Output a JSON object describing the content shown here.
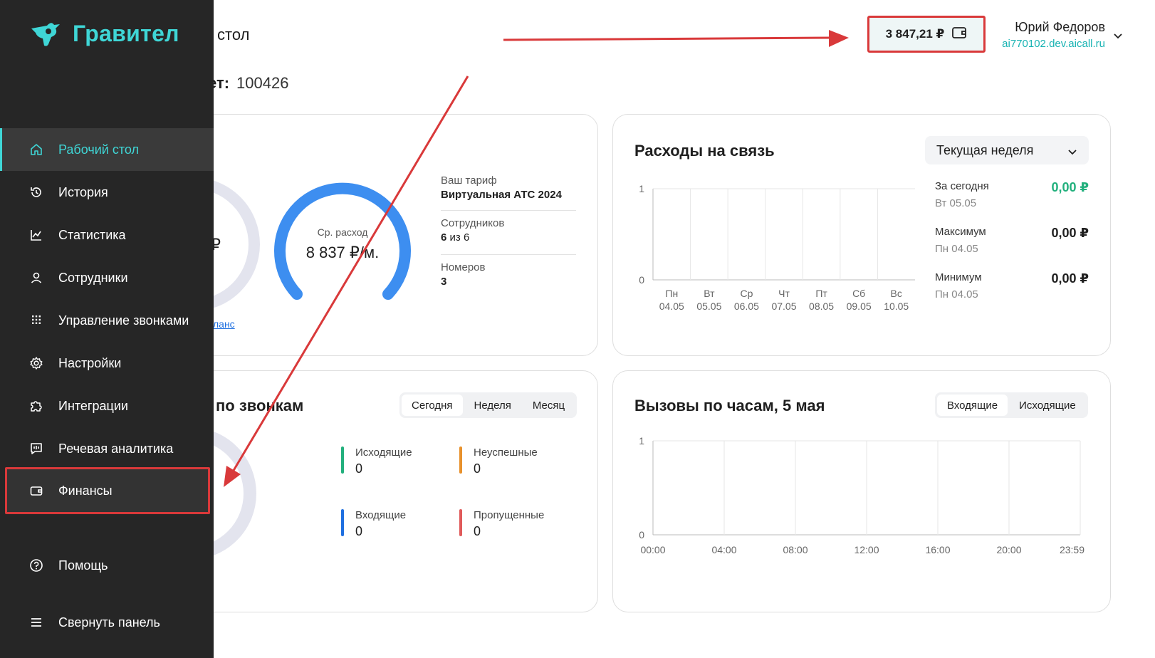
{
  "sidebar": {
    "logo_text": "Гравител",
    "items": [
      {
        "label": "Рабочий стол",
        "icon": "home-icon"
      },
      {
        "label": "История",
        "icon": "history-icon"
      },
      {
        "label": "Статистика",
        "icon": "chart-icon"
      },
      {
        "label": "Сотрудники",
        "icon": "user-icon"
      },
      {
        "label": "Управление звонками",
        "icon": "dialpad-icon"
      },
      {
        "label": "Настройки",
        "icon": "gear-icon"
      },
      {
        "label": "Интеграции",
        "icon": "puzzle-icon"
      },
      {
        "label": "Речевая аналитика",
        "icon": "speech-icon"
      },
      {
        "label": "Финансы",
        "icon": "wallet-icon"
      }
    ],
    "help_label": "Помощь",
    "collapse_label": "Свернуть панель"
  },
  "header": {
    "title_fragment": "стол",
    "account_label": "ет:",
    "account_number": "100426",
    "balance": "3 847,21 ₽",
    "user_name": "Юрий Федоров",
    "user_domain": "ai770102.dev.aicall.ru"
  },
  "tariff_card": {
    "gauge_fragment": "₽",
    "avg_label": "Ср. расход",
    "avg_value": "8 837 ₽/м.",
    "link_fragment": "ланс",
    "tariff_label": "Ваш тариф",
    "tariff_value": "Виртуальная АТС 2024",
    "employees_label": "Сотрудников",
    "employees_value": "6",
    "employees_of": "из 6",
    "numbers_label": "Номеров",
    "numbers_value": "3"
  },
  "expenses_card": {
    "title": "Расходы на связь",
    "period": "Текущая неделя",
    "today_label": "За сегодня",
    "today_date": "Вт 05.05",
    "today_value": "0,00 ₽",
    "max_label": "Максимум",
    "max_date": "Пн 04.05",
    "max_value": "0,00 ₽",
    "min_label": "Минимум",
    "min_date": "Пн 04.05",
    "min_value": "0,00 ₽"
  },
  "calls_card": {
    "title_fragment": "по звонкам",
    "tabs": [
      "Сегодня",
      "Неделя",
      "Месяц"
    ],
    "outgoing_label": "Исходящие",
    "outgoing_value": "0",
    "failed_label": "Неуспешные",
    "failed_value": "0",
    "incoming_label": "Входящие",
    "incoming_value": "0",
    "missed_label": "Пропущенные",
    "missed_value": "0"
  },
  "hourly_card": {
    "title": "Вызовы по часам, 5 мая",
    "tabs": [
      "Входящие",
      "Исходящие"
    ]
  },
  "chart_data": [
    {
      "type": "bar",
      "categories": [
        "Пн 04.05",
        "Вт 05.05",
        "Ср 06.05",
        "Чт 07.05",
        "Пт 08.05",
        "Сб 09.05",
        "Вс 10.05"
      ],
      "cat_day": [
        "Пн",
        "Вт",
        "Ср",
        "Чт",
        "Пт",
        "Сб",
        "Вс"
      ],
      "cat_date": [
        "04.05",
        "05.05",
        "06.05",
        "07.05",
        "08.05",
        "09.05",
        "10.05"
      ],
      "values": [
        0,
        0,
        0,
        0,
        0,
        0,
        0
      ],
      "ylim": [
        0,
        1
      ],
      "yticks": [
        "0",
        "1"
      ]
    },
    {
      "type": "line",
      "x": [
        "00:00",
        "04:00",
        "08:00",
        "12:00",
        "16:00",
        "20:00",
        "23:59"
      ],
      "values": [
        0,
        0,
        0,
        0,
        0,
        0,
        0
      ],
      "ylim": [
        0,
        1
      ],
      "yticks": [
        "0",
        "1"
      ]
    }
  ],
  "colors": {
    "accent": "#3fd6d6",
    "sidebar_bg": "#262626",
    "annotation_red": "#d9393a",
    "gauge_blue": "#3d8ef0",
    "gauge_track": "#e3e4ee",
    "positive_green": "#22b07d",
    "outgoing": "#22b07d",
    "failed": "#e8912c",
    "incoming": "#1e6fe0",
    "missed": "#e05a5a"
  }
}
